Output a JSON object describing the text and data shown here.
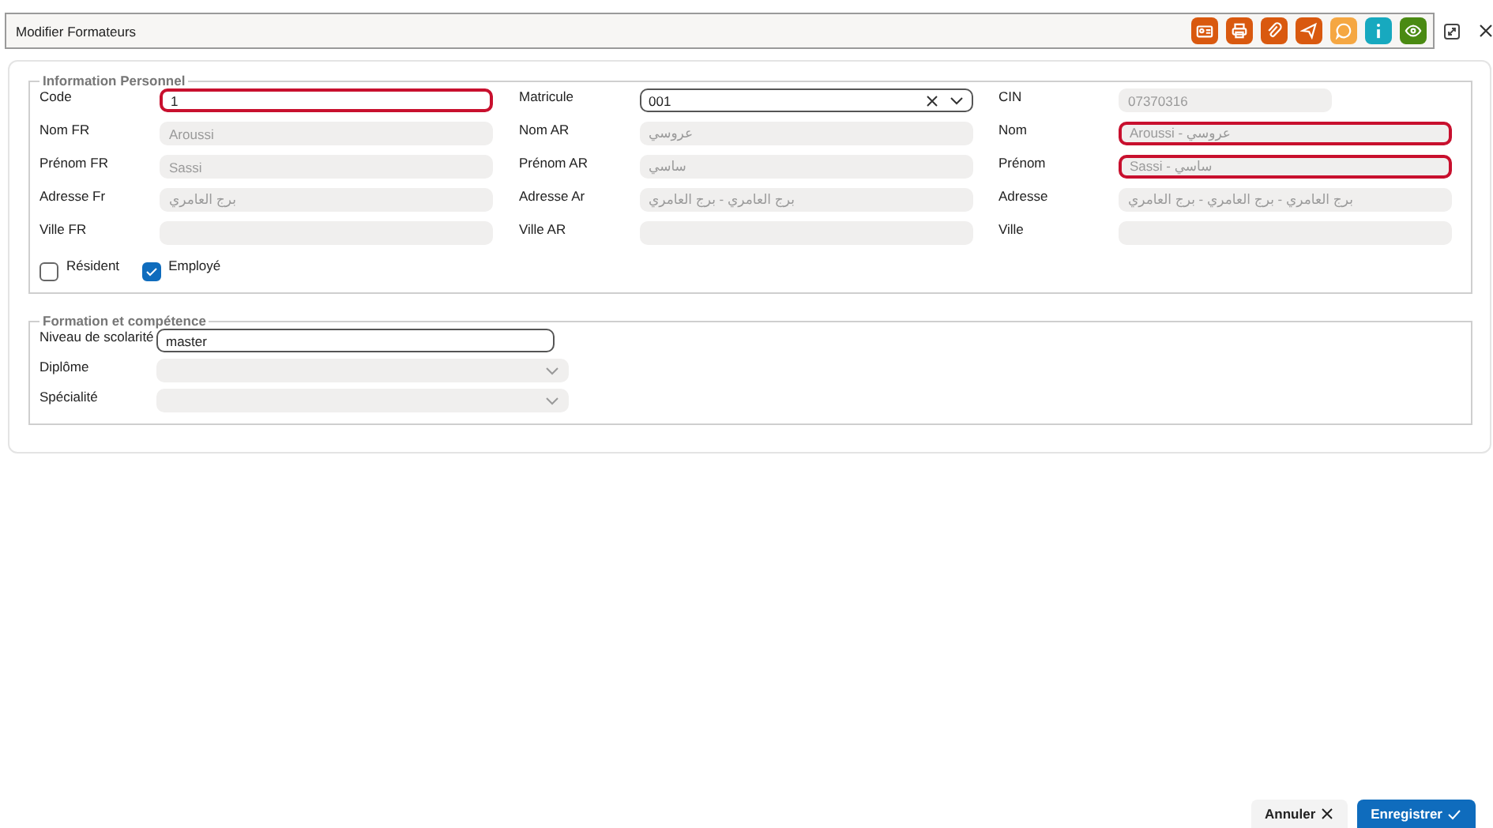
{
  "window": {
    "title": "Modifier Formateurs"
  },
  "toolbar": [
    {
      "kind": "id-card",
      "color": "#d9590f"
    },
    {
      "kind": "print",
      "color": "#d9590f"
    },
    {
      "kind": "attach",
      "color": "#d9590f"
    },
    {
      "kind": "send",
      "color": "#d9590f"
    },
    {
      "kind": "comment",
      "color": "#f5a742"
    },
    {
      "kind": "info",
      "color": "#17a9bf"
    },
    {
      "kind": "view",
      "color": "#4a8a12"
    }
  ],
  "sections": [
    {
      "title": "Information Personnel",
      "fields": [
        {
          "label": "Code",
          "value": "1",
          "kind": "text",
          "disabled": false,
          "error": true
        },
        {
          "label": "Matricule",
          "value": "001",
          "kind": "combo",
          "disabled": false,
          "error": false
        },
        {
          "label": "CIN",
          "value": "07370316",
          "kind": "short",
          "disabled": true,
          "error": false
        },
        {
          "label": "Nom FR",
          "value": "Aroussi",
          "kind": "text",
          "disabled": true,
          "error": false
        },
        {
          "label": "Nom AR",
          "value": "عروسي",
          "kind": "text",
          "disabled": true,
          "error": false
        },
        {
          "label": "Nom",
          "value": "Aroussi - عروسي",
          "kind": "text",
          "disabled": true,
          "error": true
        },
        {
          "label": "Prénom FR",
          "value": "Sassi",
          "kind": "text",
          "disabled": true,
          "error": false
        },
        {
          "label": "Prénom AR",
          "value": "ساسي",
          "kind": "text",
          "disabled": true,
          "error": false
        },
        {
          "label": "Prénom",
          "value": "Sassi - ساسي",
          "kind": "text",
          "disabled": true,
          "error": true
        },
        {
          "label": "Adresse Fr",
          "value": "برج العامري",
          "kind": "text",
          "disabled": true,
          "error": false
        },
        {
          "label": "Adresse Ar",
          "value": "برج العامري - برج العامري",
          "kind": "text",
          "disabled": true,
          "error": false
        },
        {
          "label": "Adresse",
          "value": "برج العامري - برج العامري - برج العامري",
          "kind": "text",
          "disabled": true,
          "error": false
        },
        {
          "label": "Ville FR",
          "kind": "text",
          "disabled": true,
          "error": false
        },
        {
          "label": "Ville AR",
          "kind": "text",
          "disabled": true,
          "error": false
        },
        {
          "label": "Ville",
          "kind": "text",
          "disabled": true,
          "error": false
        }
      ],
      "checkboxes": [
        {
          "label": "Résident",
          "checked": false
        },
        {
          "label": "Employé",
          "checked": true
        }
      ]
    },
    {
      "title": "Formation et compétence",
      "fields": [
        {
          "label": "Niveau de scolarité",
          "value": "master",
          "kind": "text",
          "disabled": false,
          "error": false
        },
        {
          "label": "Diplôme",
          "kind": "select",
          "disabled": true,
          "error": false
        },
        {
          "label": "Spécialité",
          "kind": "select",
          "disabled": true,
          "error": false
        }
      ]
    }
  ],
  "buttons": [
    {
      "label": "Annuler",
      "kind": "cancel"
    },
    {
      "label": "Enregistrer",
      "kind": "save"
    }
  ]
}
